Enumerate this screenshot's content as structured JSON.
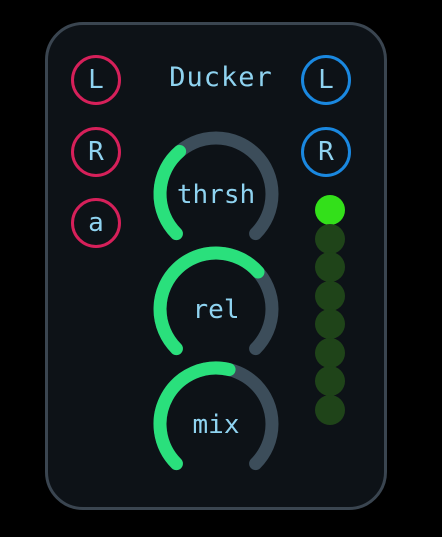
{
  "module": {
    "title": "Ducker"
  },
  "inputs": [
    {
      "label": "L"
    },
    {
      "label": "R"
    },
    {
      "label": "a"
    }
  ],
  "outputs": [
    {
      "label": "L"
    },
    {
      "label": "R"
    }
  ],
  "knobs": [
    {
      "label": "thrsh",
      "value": 0.35
    },
    {
      "label": "rel",
      "value": 0.68
    },
    {
      "label": "mix",
      "value": 0.55
    }
  ],
  "meter": {
    "segments": 8,
    "lit": 1
  },
  "colors": {
    "panel_border": "#3a4550",
    "text": "#8fd3f0",
    "input_ring": "#d6205a",
    "output_ring": "#1a88e0",
    "knob_track": "#3c4d5a",
    "knob_value": "#2ae07c",
    "led_on": "#33e01a",
    "led_off": "#1f4419"
  }
}
